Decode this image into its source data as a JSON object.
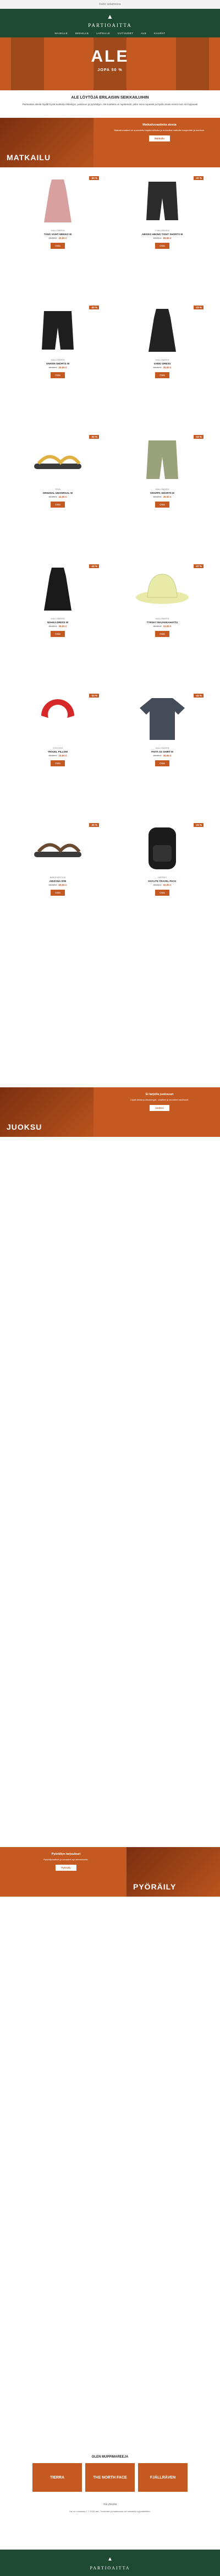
{
  "preheader": "Katso selaimessa",
  "brand_name": "PARTIOAITTA",
  "nav": [
    "NAISILLE",
    "MIEHILLE",
    "LAPSILLE",
    "UUTUUDET",
    "ALE",
    "KAUPAT"
  ],
  "hero": {
    "title": "ALE",
    "subtitle": "JOPA 50 %"
  },
  "intro": {
    "heading": "ALE LÖYTÖJÄ ERILAISIIN SEIKKAILUIHIN",
    "text": "Partioaitan alesta löydät hyviä tuotteita retkeilyyn, juoksuun ja pyöräilyyn. Ale-tuotteita on rajoitetusti, joten toimi nopeasti ja löydä omasi ennen kuin ne loppuvat!"
  },
  "sections": [
    {
      "label": "MATKAILU",
      "heading": "Matkailuvaatteita alesta",
      "text": "Matkailuvaatteet on suunniteltu käytännöllisiksi ja mukaviksi matkoille kaupunkiin ja luontoon.",
      "cta": "Matkailu"
    },
    {
      "label": "JUOKSU",
      "heading": "Ei tarjolla juoksuun",
      "text": "Löydä alesta juoksukengät, -vaatteet ja varusteet edullisesti.",
      "cta": "Juoksu"
    },
    {
      "label": "PYÖRÄILY",
      "heading": "Pyöräilyn tarjoukset",
      "text": "Pyöräilyvaatteet ja varusteet nyt alennuksella.",
      "cta": "Pyöräily"
    }
  ],
  "products": [
    {
      "brand": "HALLOWEEN",
      "name": "TÄNÄ VAIHT MEKKO W",
      "old": "59,90 €",
      "new": "29,95 €",
      "disc": "-50 %",
      "color": "#d9a0a0",
      "shape": "dress"
    },
    {
      "brand": "FJÄLLRÄVEN",
      "name": "ABISKO HIKING TIGHT SHORTS M",
      "old": "99,95 €",
      "new": "69,95 €",
      "disc": "-30 %",
      "color": "#2b2b2b",
      "shape": "shorts"
    },
    {
      "brand": "HALLOWEEN",
      "name": "VAHVIN SHORTS W",
      "old": "49,90 €",
      "new": "29,95 €",
      "disc": "-40 %",
      "color": "#1e1e1e",
      "shape": "shorts"
    },
    {
      "brand": "HALLOWEEN",
      "name": "VARIO DRESS",
      "old": "59,90 €",
      "new": "39,95 €",
      "disc": "-33 %",
      "color": "#222222",
      "shape": "dress"
    },
    {
      "brand": "TEVA",
      "name": "ORIGINAL UNIVERSAL W",
      "old": "64,90 €",
      "new": "44,95 €",
      "disc": "-30 %",
      "color": "#e0b040",
      "shape": "sandal"
    },
    {
      "brand": "HALLOWEEN",
      "name": "KRAPPA SHORTS M",
      "old": "59,90 €",
      "new": "39,95 €",
      "disc": "-33 %",
      "color": "#9aa27c",
      "shape": "shorts"
    },
    {
      "brand": "HALLOWEEN",
      "name": "NAHKA DRESS W",
      "old": "69,90 €",
      "new": "39,95 €",
      "disc": "-42 %",
      "color": "#1a1a1a",
      "shape": "dress"
    },
    {
      "brand": "HALLOWEEN",
      "name": "TYRSKY MAJAKKAHATTU",
      "old": "39,90 €",
      "new": "24,95 €",
      "disc": "-37 %",
      "color": "#e8eaa8",
      "shape": "hat"
    },
    {
      "brand": "COCOON",
      "name": "TRAVEL PILLOW",
      "old": "29,90 €",
      "new": "19,95 €",
      "disc": "-33 %",
      "color": "#d62828",
      "shape": "pillow"
    },
    {
      "brand": "HALLOWEEN",
      "name": "PAITA SS SHIRT M",
      "old": "69,90 €",
      "new": "39,95 €",
      "disc": "-42 %",
      "color": "#444c5a",
      "shape": "shirt"
    },
    {
      "brand": "BIRKENSTOCK",
      "name": "ARIZONA SFB",
      "old": "99,90 €",
      "new": "69,95 €",
      "disc": "-30 %",
      "color": "#6b4a32",
      "shape": "sandal"
    },
    {
      "brand": "OSPREY",
      "name": "DAYLITE TRAVEL PACK",
      "old": "89,90 €",
      "new": "59,95 €",
      "disc": "-33 %",
      "color": "#1b1b1b",
      "shape": "pack"
    }
  ]
}
